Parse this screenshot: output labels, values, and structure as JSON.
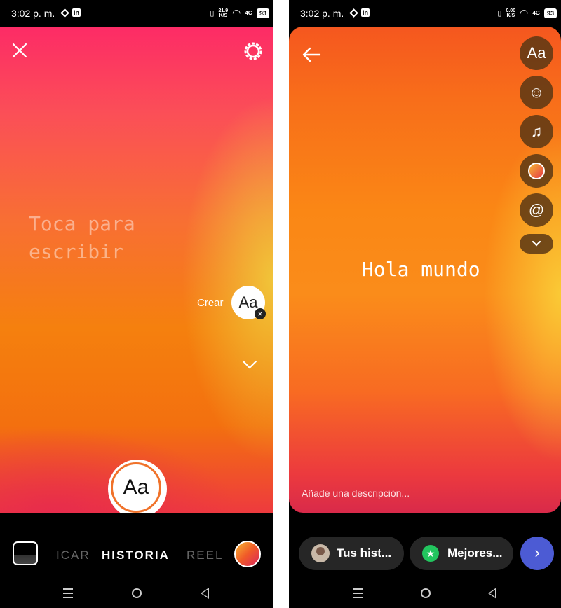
{
  "left": {
    "status": {
      "time": "3:02 p. m.",
      "speed": "21.9",
      "speed_unit": "K/S",
      "network": "4G",
      "battery": "93"
    },
    "placeholder": "Toca para\nescribir",
    "create_label": "Crear",
    "create_button": "Aa",
    "shutter_label": "Aa",
    "modes": [
      "ICAR",
      "HISTORIA",
      "REEL"
    ],
    "active_mode": "HISTORIA"
  },
  "right": {
    "status": {
      "time": "3:02 p. m.",
      "speed": "0.00",
      "speed_unit": "K/S",
      "network": "4G",
      "battery": "93"
    },
    "tools": [
      {
        "name": "text-tool",
        "glyph": "Aa"
      },
      {
        "name": "sticker-tool",
        "glyph": "☺"
      },
      {
        "name": "music-tool",
        "glyph": "♫"
      },
      {
        "name": "color-tool",
        "glyph": ""
      },
      {
        "name": "mention-tool",
        "glyph": "@"
      }
    ],
    "story_text": "Hola mundo",
    "description_placeholder": "Añade una descripción...",
    "share_your_story": "Tus hist...",
    "share_close_friends": "Mejores...",
    "next_glyph": "›"
  },
  "colors": {
    "accent_blue": "#4c5bd4",
    "close_friends_green": "#22c55e",
    "shutter_ring": "#f0722a"
  }
}
